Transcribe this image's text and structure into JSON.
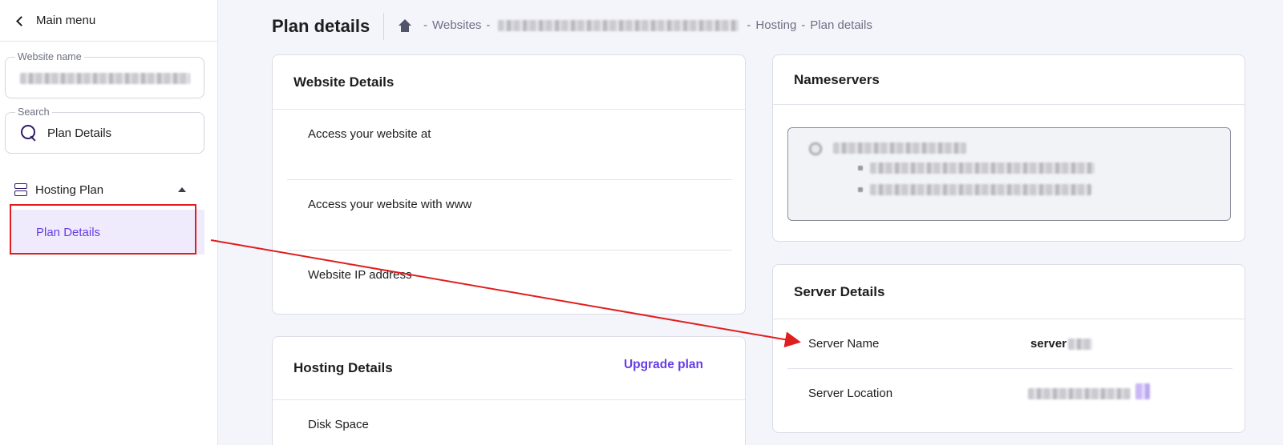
{
  "sidebar": {
    "main_menu_label": "Main menu",
    "website_field": {
      "label": "Website name",
      "value": ""
    },
    "search_field": {
      "label": "Search",
      "value": "Plan Details"
    },
    "group": {
      "label": "Hosting Plan",
      "icon": "server-icon",
      "expanded": true
    },
    "active_item": "Plan Details"
  },
  "header": {
    "title": "Plan details",
    "breadcrumb": {
      "home_icon": "home-icon",
      "items": [
        "Websites",
        "Hosting",
        "Plan details"
      ],
      "separator": "-"
    }
  },
  "website_details": {
    "title": "Website Details",
    "rows": [
      {
        "label": "Access your website at"
      },
      {
        "label": "Access your website with www"
      },
      {
        "label": "Website IP address"
      }
    ]
  },
  "hosting_details": {
    "title": "Hosting Details",
    "upgrade_label": "Upgrade plan",
    "rows": [
      {
        "label": "Disk Space"
      }
    ]
  },
  "nameservers": {
    "title": "Nameservers"
  },
  "server_details": {
    "title": "Server Details",
    "rows": [
      {
        "label": "Server Name",
        "value": "server"
      },
      {
        "label": "Server Location"
      }
    ]
  },
  "colors": {
    "accent": "#673de6",
    "active_bg": "#efebfd",
    "annotation": "#e01e1e",
    "page_bg": "#f4f4fb"
  }
}
